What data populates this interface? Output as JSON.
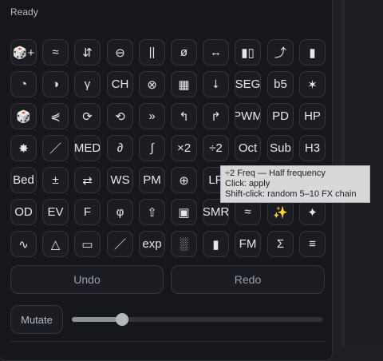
{
  "status": "Ready",
  "fx_grid": {
    "rows": [
      [
        {
          "label": "🎲+",
          "name": "random-plus-button"
        },
        {
          "label": "≈",
          "name": "approx-button"
        },
        {
          "label": "⇵",
          "name": "swap-updown-button"
        },
        {
          "label": "⊖",
          "name": "circle-minus-button"
        },
        {
          "label": "||",
          "name": "double-bar-button"
        },
        {
          "label": "ø",
          "name": "phase-button"
        },
        {
          "label": "↔",
          "name": "stereo-width-button"
        },
        {
          "label": "▮▯",
          "name": "pan-button"
        },
        {
          "label": "⤴",
          "name": "curve-up-button"
        },
        {
          "label": "▮",
          "name": "block-button"
        }
      ],
      [
        {
          "label": "◔",
          "name": "quarter-circle-button"
        },
        {
          "label": "◑",
          "name": "half-circle-button"
        },
        {
          "label": "γ",
          "name": "gamma-button"
        },
        {
          "label": "CH",
          "name": "chorus-button"
        },
        {
          "label": "⊗",
          "name": "circle-times-button"
        },
        {
          "label": "▦",
          "name": "grid-button"
        },
        {
          "label": "⭣",
          "name": "down-arrow-button"
        },
        {
          "label": "SEG",
          "name": "segment-button"
        },
        {
          "label": "b5",
          "name": "flat-five-button"
        },
        {
          "label": "✶",
          "name": "star-button"
        }
      ],
      [
        {
          "label": "🎲",
          "name": "dice-button"
        },
        {
          "label": "⋞",
          "name": "fan-button"
        },
        {
          "label": "⟳",
          "name": "loop-button"
        },
        {
          "label": "⟲",
          "name": "reverse-loop-button"
        },
        {
          "label": "»",
          "name": "fast-forward-button"
        },
        {
          "label": "↰",
          "name": "turn-left-button"
        },
        {
          "label": "↱",
          "name": "turn-right-button"
        },
        {
          "label": "PWM",
          "name": "pwm-button"
        },
        {
          "label": "PD",
          "name": "pd-button"
        },
        {
          "label": "HP",
          "name": "highpass-button"
        }
      ],
      [
        {
          "label": "✸",
          "name": "burst-button"
        },
        {
          "label": "／",
          "name": "slash-button"
        },
        {
          "label": "MED",
          "name": "median-button"
        },
        {
          "label": "∂",
          "name": "partial-button"
        },
        {
          "label": "∫",
          "name": "integral-button"
        },
        {
          "label": "×2",
          "name": "double-freq-button"
        },
        {
          "label": "÷2",
          "name": "half-freq-button"
        },
        {
          "label": "Oct",
          "name": "octave-button"
        },
        {
          "label": "Sub",
          "name": "sub-button"
        },
        {
          "label": "H3",
          "name": "h3-button"
        }
      ],
      [
        {
          "label": "Bed",
          "name": "bed-button"
        },
        {
          "label": "±",
          "name": "plus-minus-button"
        },
        {
          "label": "⇄",
          "name": "exchange-button"
        },
        {
          "label": "WS",
          "name": "waveshape-button"
        },
        {
          "label": "PM",
          "name": "pm-button"
        },
        {
          "label": "⊕",
          "name": "circle-plus-button"
        },
        {
          "label": "LP",
          "name": "lowpass-button"
        }
      ],
      [
        {
          "label": "OD",
          "name": "overdrive-button"
        },
        {
          "label": "EV",
          "name": "ev-button"
        },
        {
          "label": "F",
          "name": "f-button"
        },
        {
          "label": "φ",
          "name": "phi-button"
        },
        {
          "label": "⇧",
          "name": "shift-up-button"
        },
        {
          "label": "▣",
          "name": "square-in-square-button"
        },
        {
          "label": "SMR",
          "name": "smear-button"
        },
        {
          "label": "≈",
          "name": "approx-2-button"
        },
        {
          "label": "✨",
          "name": "sparkle-button"
        },
        {
          "label": "✦",
          "name": "four-star-button"
        }
      ],
      [
        {
          "label": "∿",
          "name": "sine-button"
        },
        {
          "label": "△",
          "name": "triangle-button"
        },
        {
          "label": "▭",
          "name": "rectangle-button"
        },
        {
          "label": "／",
          "name": "saw-button"
        },
        {
          "label": "exp",
          "name": "exp-button"
        },
        {
          "label": "░",
          "name": "noise-button"
        },
        {
          "label": "▮",
          "name": "bar-button"
        },
        {
          "label": "FM",
          "name": "fm-button"
        },
        {
          "label": "Σ",
          "name": "sum-button"
        },
        {
          "label": "≡",
          "name": "menu-lines-button"
        }
      ]
    ]
  },
  "actions": {
    "undo": "Undo",
    "redo": "Redo",
    "mutate": "Mutate"
  },
  "mutate_slider": {
    "value_fraction": 0.2
  },
  "tooltip": {
    "line1": "÷2 Freq — Half frequency",
    "line2": "Click: apply",
    "line3": "Shift-click: random 5–10 FX chain"
  }
}
